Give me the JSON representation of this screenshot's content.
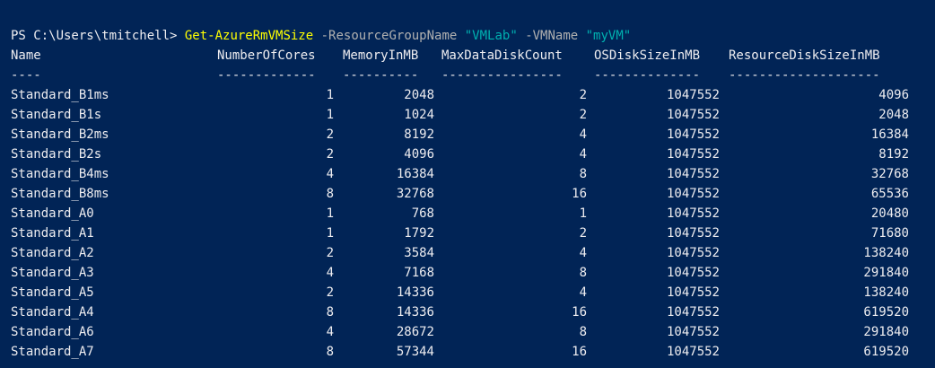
{
  "prompt": {
    "path": "PS C:\\Users\\tmitchell> ",
    "command": "Get-AzureRmVMSize",
    "param1": " -ResourceGroupName ",
    "value1": "\"VMLab\"",
    "param2": " -VMName ",
    "value2": "\"myVM\""
  },
  "table": {
    "headers": [
      "Name",
      "NumberOfCores",
      "MemoryInMB",
      "MaxDataDiskCount",
      "OSDiskSizeInMB",
      "ResourceDiskSizeInMB"
    ],
    "dashes": [
      "----",
      "-------------",
      "----------",
      "----------------",
      "--------------",
      "--------------------"
    ],
    "rows": [
      [
        "Standard_B1ms",
        "1",
        "2048",
        "2",
        "1047552",
        "4096"
      ],
      [
        "Standard_B1s",
        "1",
        "1024",
        "2",
        "1047552",
        "2048"
      ],
      [
        "Standard_B2ms",
        "2",
        "8192",
        "4",
        "1047552",
        "16384"
      ],
      [
        "Standard_B2s",
        "2",
        "4096",
        "4",
        "1047552",
        "8192"
      ],
      [
        "Standard_B4ms",
        "4",
        "16384",
        "8",
        "1047552",
        "32768"
      ],
      [
        "Standard_B8ms",
        "8",
        "32768",
        "16",
        "1047552",
        "65536"
      ],
      [
        "Standard_A0",
        "1",
        "768",
        "1",
        "1047552",
        "20480"
      ],
      [
        "Standard_A1",
        "1",
        "1792",
        "2",
        "1047552",
        "71680"
      ],
      [
        "Standard_A2",
        "2",
        "3584",
        "4",
        "1047552",
        "138240"
      ],
      [
        "Standard_A3",
        "4",
        "7168",
        "8",
        "1047552",
        "291840"
      ],
      [
        "Standard_A5",
        "2",
        "14336",
        "4",
        "1047552",
        "138240"
      ],
      [
        "Standard_A4",
        "8",
        "14336",
        "16",
        "1047552",
        "619520"
      ],
      [
        "Standard_A6",
        "4",
        "28672",
        "8",
        "1047552",
        "291840"
      ],
      [
        "Standard_A7",
        "8",
        "57344",
        "16",
        "1047552",
        "619520"
      ]
    ]
  },
  "colors": {
    "background": "#012456",
    "text": "#eeedf0",
    "command": "#ffff00",
    "parameter": "#b0b0b0",
    "string": "#00b0b0"
  }
}
